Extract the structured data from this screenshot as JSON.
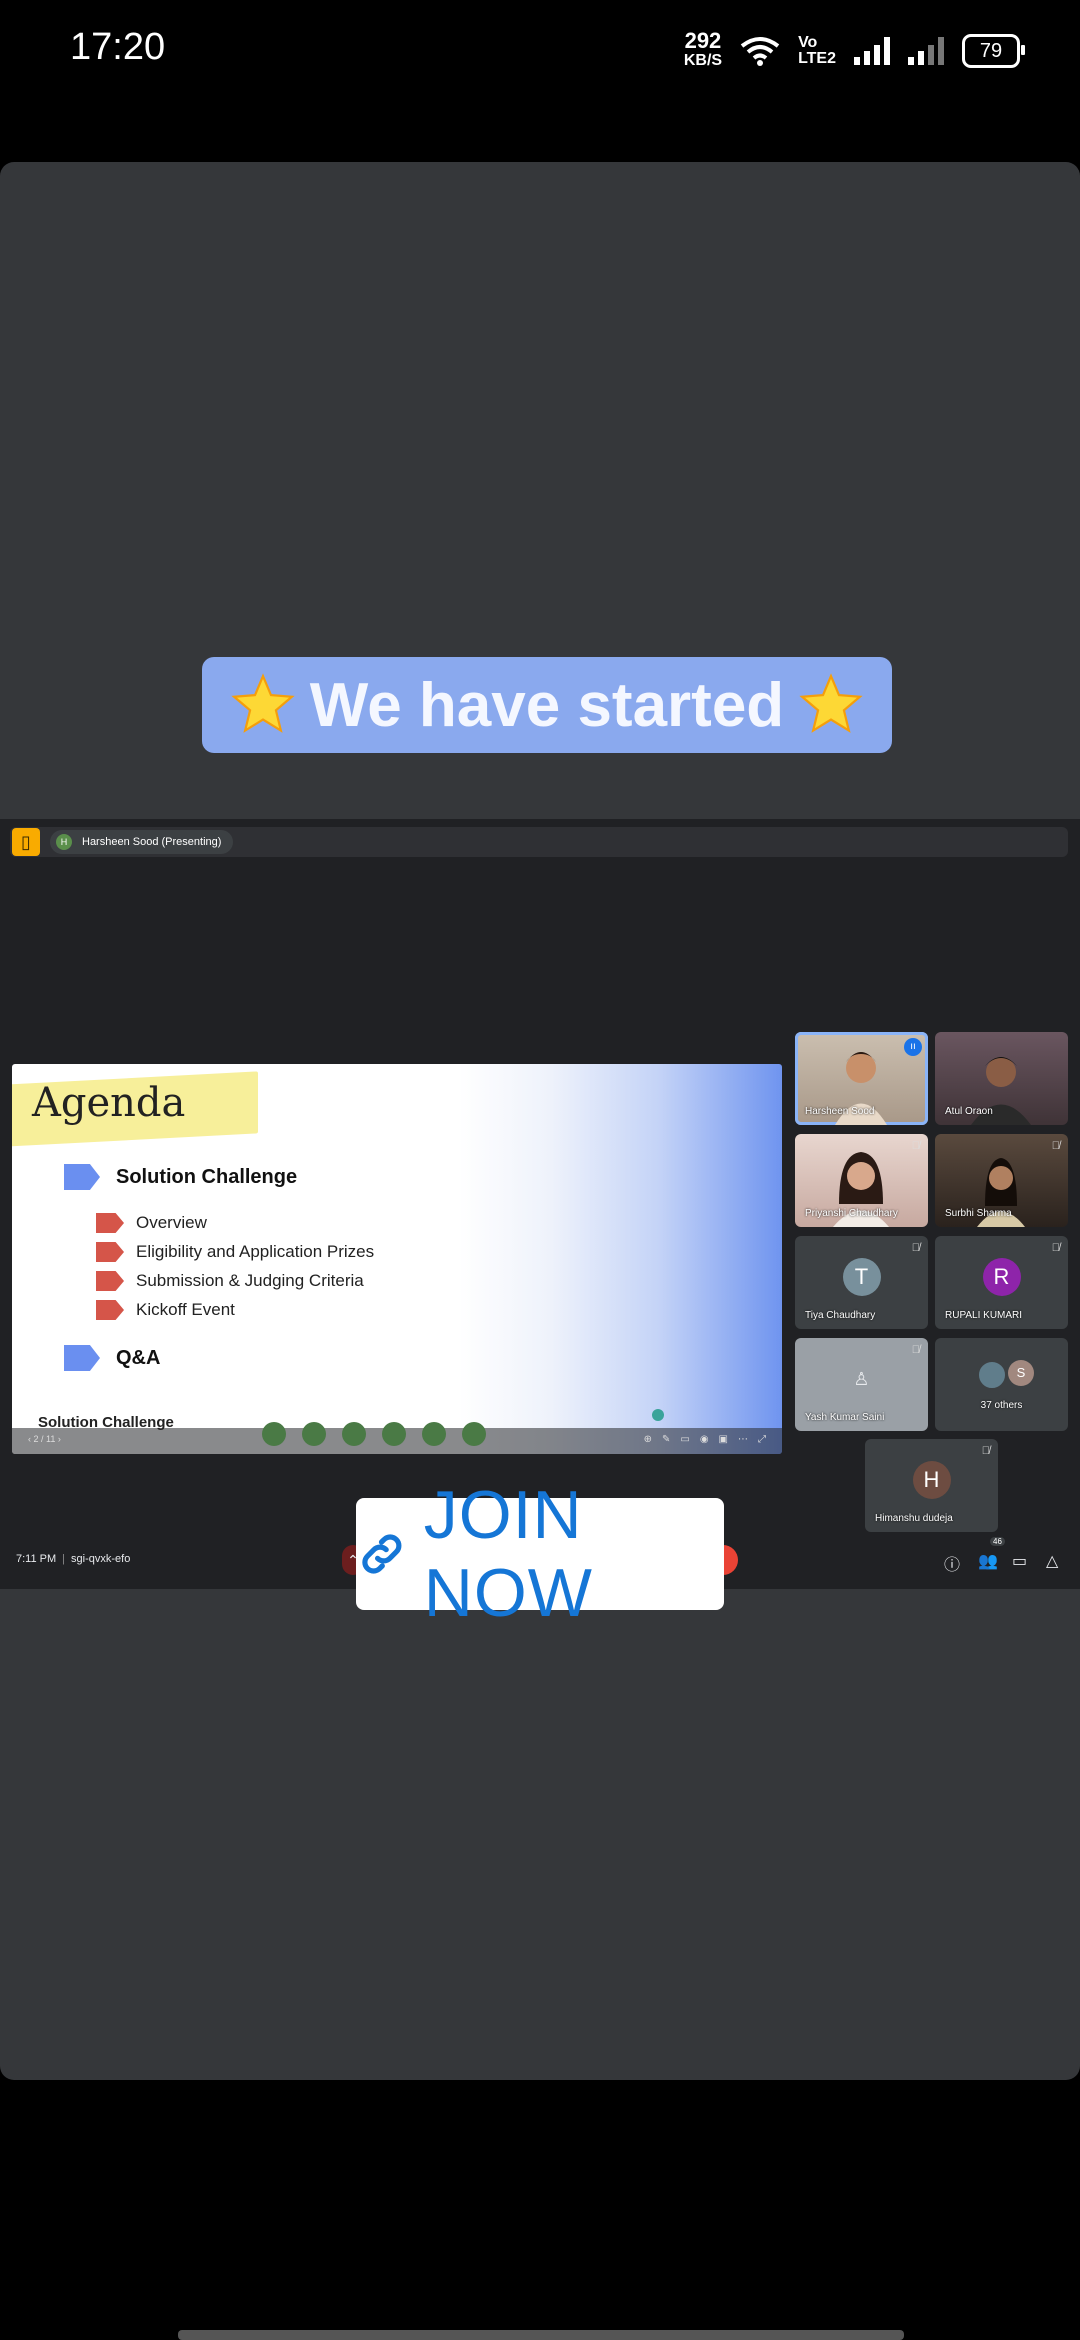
{
  "status_bar": {
    "time": "17:20",
    "net_speed": "292",
    "net_speed_unit": "KB/S",
    "volte_line1": "Vo",
    "volte_line2": "LTE2",
    "battery": "79"
  },
  "post": {
    "banner_text": "We have started",
    "star_icon": "star-emoji",
    "join_label": "JOIN NOW",
    "join_icon": "link-icon",
    "colors": {
      "card_bg": "#35373a",
      "banner_bg": "#8aa9ee",
      "join_text": "#1576d6"
    }
  },
  "meet": {
    "presenter_initial": "H",
    "presenter_label": "Harsheen Sood (Presenting)",
    "slide": {
      "title": "Agenda",
      "sections": [
        {
          "label": "Solution Challenge",
          "items": [
            "Overview",
            "Eligibility and Application  Prizes",
            "Submission & Judging Criteria",
            "Kickoff Event"
          ]
        },
        {
          "label": "Q&A",
          "items": []
        }
      ],
      "footer": "Solution Challenge",
      "page": "2 / 11"
    },
    "participants": [
      {
        "name": "Harsheen Sood",
        "type": "video",
        "active": true
      },
      {
        "name": "Atul Oraon",
        "type": "video"
      },
      {
        "name": "Priyanshi Chaudhary",
        "type": "video",
        "muted": true
      },
      {
        "name": "Surbhi Sharma",
        "type": "video",
        "muted": true
      },
      {
        "name": "Tiya Chaudhary",
        "initial": "T",
        "type": "avatar",
        "muted": true
      },
      {
        "name": "RUPALI KUMARI",
        "initial": "R",
        "type": "avatar",
        "muted": true
      },
      {
        "name": "Yash Kumar Saini",
        "type": "avatar",
        "muted": true
      },
      {
        "name": "37 others",
        "initial": "S",
        "type": "others"
      },
      {
        "name": "Himanshu dudeja",
        "initial": "H",
        "type": "avatar",
        "muted": true
      }
    ],
    "meeting_time": "7:11 PM",
    "meeting_code": "sgi-qvxk-efo",
    "participant_count": "46"
  }
}
